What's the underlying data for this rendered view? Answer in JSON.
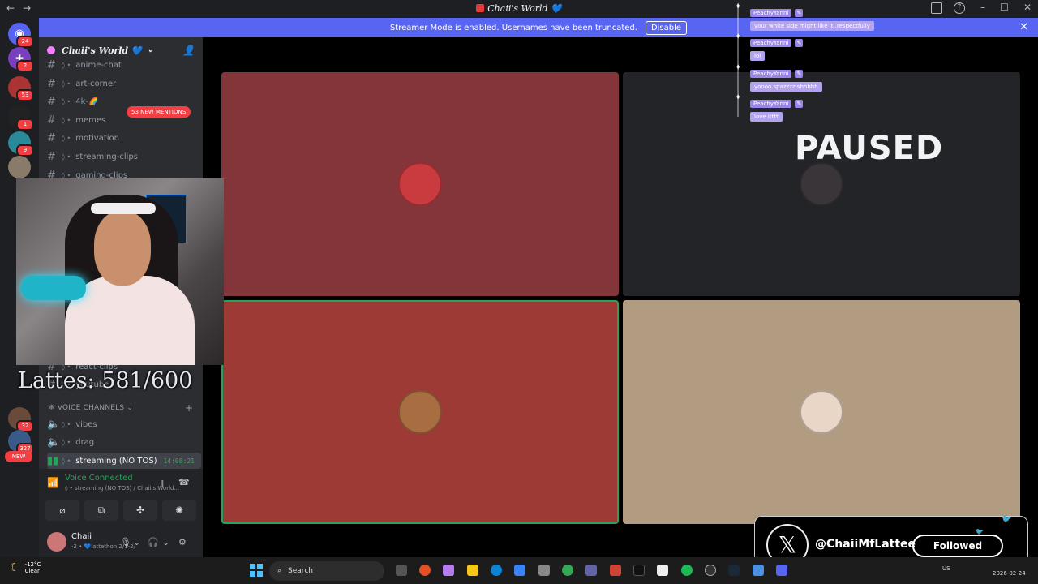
{
  "window": {
    "title": "Chaii's World 💙"
  },
  "banner": {
    "text": "Streamer Mode is enabled. Usernames have been truncated.",
    "button": "Disable"
  },
  "rail": {
    "badges": [
      "24",
      "2",
      "53",
      "1",
      "9",
      "32",
      "327"
    ],
    "new_label": "NEW"
  },
  "sidebar": {
    "server_name": "Chaii's World 💙",
    "mentions": "53 NEW MENTIONS",
    "text_channels": [
      "anime-chat",
      "art-corner",
      "4k-🌈",
      "memes",
      "motivation",
      "streaming-clips",
      "gaming-clips"
    ],
    "partial_channels": [
      "react-clips",
      "youtube"
    ],
    "voice_header": "VOICE CHANNELS",
    "voice_channels": [
      "vibes",
      "drag",
      "streaming (NO TOS)"
    ],
    "active_time": "14:08:21"
  },
  "voice_panel": {
    "status": "Voice Connected",
    "location": "streaming (NO TOS) / Chaii's World...",
    "user": "Chaii",
    "user_status": "-2 • 💙lattethon 2/1-2/"
  },
  "stage": {
    "paused_label": "PAUSED",
    "tiles": [
      {
        "color": "#843539",
        "avatar": "#c93b3f"
      },
      {
        "color": "#232428",
        "avatar": "#3a3538"
      },
      {
        "color": "#9d3a35",
        "avatar": "#a86d40"
      },
      {
        "color": "#b19c82",
        "avatar": "#e9d6c6"
      }
    ]
  },
  "overlay": {
    "lattes": "Lattes: 581/600",
    "chat": [
      {
        "user": "PeachyYanni",
        "text": "your white side might like it..respectfully"
      },
      {
        "user": "PeachyYanni",
        "text": "lol"
      },
      {
        "user": "PeachyYanni",
        "text": "yoooo spazzzz shhhhh"
      },
      {
        "user": "PeachyYanni",
        "text": "love itttt"
      }
    ],
    "twitter_handle": "@ChaiiMfLattee",
    "twitter_button": "Followed"
  },
  "taskbar": {
    "temp": "-12°C",
    "weather": "Clear",
    "search": "Search",
    "lang": "US",
    "date": "2026-02-24"
  },
  "colors": {
    "blurple": "#5865f2",
    "green": "#23a559",
    "red": "#f23f43"
  }
}
